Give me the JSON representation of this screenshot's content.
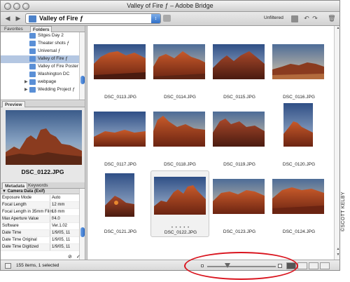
{
  "window": {
    "title": "Valley of Fire ƒ – Adobe Bridge"
  },
  "toolbar": {
    "path_label": "Valley of Fire ƒ",
    "filter_label": "Unfiltered",
    "back_icon": "back-arrow-icon",
    "forward_icon": "forward-arrow-icon"
  },
  "left_tabs": {
    "favorites": "Favorites",
    "folders": "Folders"
  },
  "folders": [
    {
      "label": "Sitges Day 2",
      "selected": false,
      "expand": ""
    },
    {
      "label": "Theater shots ƒ",
      "selected": false,
      "expand": ""
    },
    {
      "label": "Universal ƒ",
      "selected": false,
      "expand": ""
    },
    {
      "label": "Valley of Fire ƒ",
      "selected": true,
      "expand": ""
    },
    {
      "label": "Valley of Fire Poster",
      "selected": false,
      "expand": ""
    },
    {
      "label": "Washington DC",
      "selected": false,
      "expand": ""
    },
    {
      "label": "webpage",
      "selected": false,
      "expand": "▶"
    },
    {
      "label": "Wedding Project ƒ",
      "selected": false,
      "expand": "▶"
    }
  ],
  "preview": {
    "tab": "Preview",
    "filename": "DSC_0122.JPG"
  },
  "metadata": {
    "tab": "Metadata",
    "tab2": "Keywords",
    "section": "▼ Camera Data (Exif)",
    "rows": [
      {
        "key": "Exposure Mode",
        "value": "Auto"
      },
      {
        "key": "Focal Length",
        "value": "12 mm"
      },
      {
        "key": "Focal Length in 35mm Film",
        "value": "18 mm"
      },
      {
        "key": "Max Aperture Value",
        "value": "f/4.0"
      },
      {
        "key": "Software",
        "value": "Ver.1.02"
      },
      {
        "key": "Date Time",
        "value": "1/9/05, 11"
      },
      {
        "key": "Date Time Original",
        "value": "1/9/05, 11"
      },
      {
        "key": "Date Time Digitized",
        "value": "1/9/05, 11"
      }
    ]
  },
  "thumbnails": [
    {
      "caption": "DSC_0113.JPG",
      "scene": "a"
    },
    {
      "caption": "DSC_0114.JPG",
      "scene": "b"
    },
    {
      "caption": "DSC_0115.JPG",
      "scene": "c"
    },
    {
      "caption": "DSC_0116.JPG",
      "scene": "d"
    },
    {
      "caption": "DSC_0117.JPG",
      "scene": "e"
    },
    {
      "caption": "DSC_0118.JPG",
      "scene": "f"
    },
    {
      "caption": "DSC_0119.JPG",
      "scene": "g"
    },
    {
      "caption": "DSC_0120.JPG",
      "scene": "h"
    },
    {
      "caption": "DSC_0121.JPG",
      "scene": "i"
    },
    {
      "caption": "DSC_0122.JPG",
      "scene": "j",
      "selected": true,
      "rating": "• • • • •"
    },
    {
      "caption": "DSC_0123.JPG",
      "scene": "k"
    },
    {
      "caption": "DSC_0124.JPG",
      "scene": "l"
    }
  ],
  "status": {
    "count_text": "155 items, 1 selected"
  },
  "zoom": {
    "level": 0.3
  },
  "copyright": "©SCOTT KELBY",
  "colors": {
    "highlight_ring": "#d9141e",
    "selection": "#b4c7e2",
    "accent": "#2d6cc6"
  }
}
